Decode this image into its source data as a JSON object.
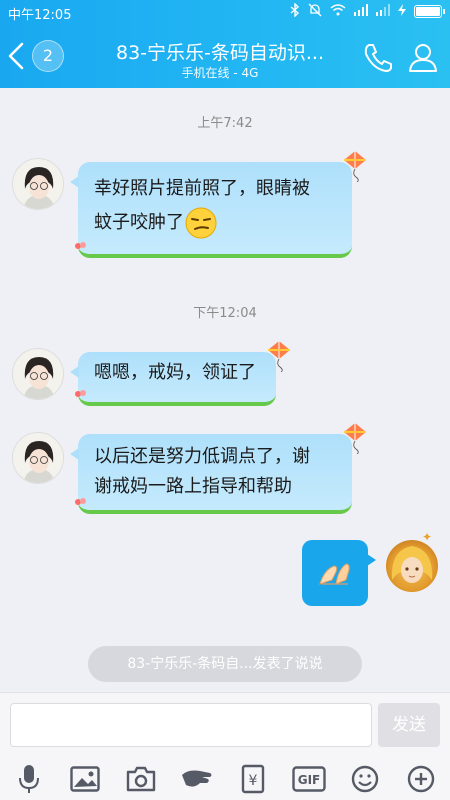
{
  "status": {
    "time": "中午12:05"
  },
  "header": {
    "title": "83-宁乐乐-条码自动识...",
    "subtitle": "手机在线 - 4G",
    "badge": "2"
  },
  "messages": {
    "ts1": "上午7:42",
    "m1_line1": "幸好照片提前照了，眼睛被",
    "m1_line2": "蚊子咬肿了",
    "ts2": "下午12:04",
    "m2": "嗯嗯，戒妈，领证了",
    "m3_line1": "以后还是努力低调点了，谢",
    "m3_line2": "谢戒妈一路上指导和帮助"
  },
  "notice": "83-宁乐乐-条码自...发表了说说",
  "input": {
    "placeholder": "",
    "send_label": "发送"
  },
  "toolbar": {
    "icons": [
      "mic-icon",
      "image-icon",
      "camera-icon",
      "red-packet-icon",
      "money-icon",
      "gif-icon",
      "emoji-icon",
      "plus-icon"
    ],
    "gif_label": "GIF",
    "yen_label": "¥"
  },
  "colors": {
    "header": "#1aa8f0",
    "bubble": "#aee0fb",
    "sent_bubble": "#1aa6ea"
  }
}
